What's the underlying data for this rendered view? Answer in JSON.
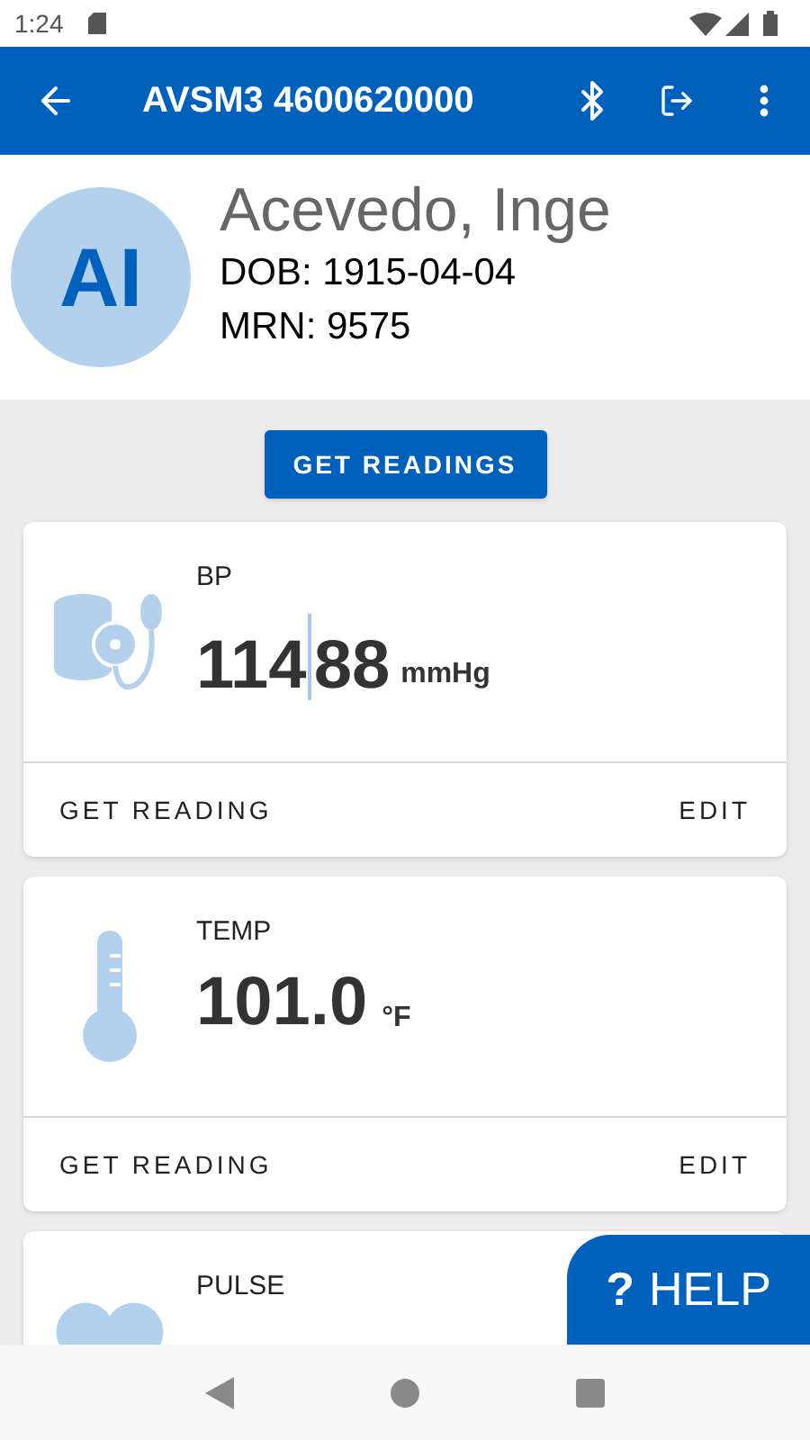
{
  "status_bar": {
    "time": "1:24"
  },
  "app_bar": {
    "title": "AVSM3 4600620000"
  },
  "patient": {
    "initials": "AI",
    "name": "Acevedo, Inge",
    "dob": "DOB: 1915-04-04",
    "mrn": "MRN: 9575"
  },
  "get_readings_button": "GET READINGS",
  "cards": [
    {
      "kind": "bp",
      "label": "BP",
      "values": [
        "114",
        "88"
      ],
      "unit": "mmHg",
      "actions": [
        "GET READING",
        "EDIT"
      ]
    },
    {
      "kind": "temp",
      "label": "TEMP",
      "values": [
        "101.0"
      ],
      "unit": "°F",
      "actions": [
        "GET READING",
        "EDIT"
      ]
    },
    {
      "kind": "pulse",
      "label": "PULSE"
    }
  ],
  "help_button": {
    "icon": "?",
    "label": "HELP"
  }
}
